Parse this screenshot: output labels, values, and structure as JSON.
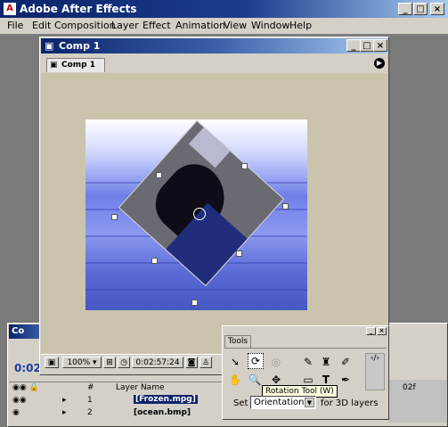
{
  "app": {
    "title": "Adobe After Effects",
    "icon": "after-effects-logo-icon",
    "window_controls": [
      "_",
      "□",
      "×"
    ]
  },
  "menu": [
    "File",
    "Edit",
    "Composition",
    "Layer",
    "Effect",
    "Animation",
    "View",
    "Window",
    "Help"
  ],
  "comp_window": {
    "title": "Comp 1",
    "tab_label": "Comp 1",
    "zoom": "100%",
    "timecode": "0:02:57:24",
    "controls": [
      "_",
      "□",
      "×"
    ]
  },
  "timeline": {
    "title": "Co",
    "timecode": "0:02",
    "columns": [
      "#",
      "Layer Name"
    ],
    "ruler_label": "02f",
    "layers": [
      {
        "num": "1",
        "name": "[Frozen.mpg]"
      },
      {
        "num": "2",
        "name": "[ocean.bmp]"
      }
    ]
  },
  "tools": {
    "title": "Tools",
    "tooltip": "Rotation Tool (W)",
    "set_label": "Set",
    "orientation_value": "Orientation",
    "suffix": "for 3D layers",
    "items": [
      "selection-tool-icon",
      "rotation-tool-icon",
      "orbit-camera-icon",
      "brush-tool-icon",
      "clone-stamp-icon",
      "eraser-icon",
      "hand-tool-icon",
      "zoom-tool-icon",
      "track-xy-camera-icon",
      "rectangle-mask-icon",
      "text-tool-icon",
      "pen-tool-icon"
    ]
  },
  "colors": {
    "titlebar": "#0a246a",
    "timecode": "#1a3da0",
    "viewer_bg": "#cbc4ad"
  }
}
